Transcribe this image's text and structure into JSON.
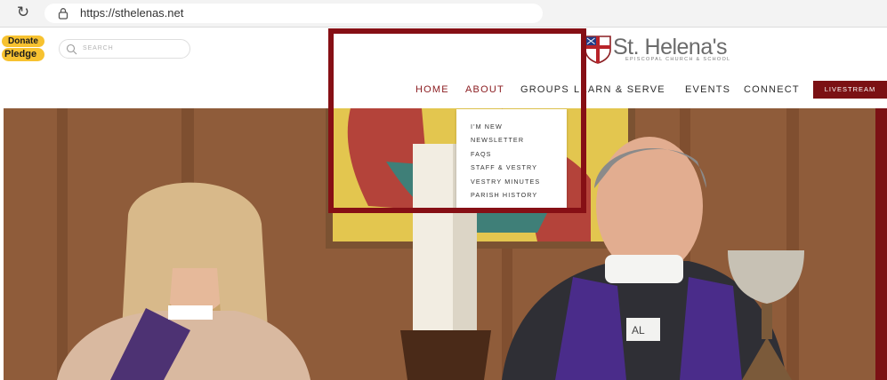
{
  "browser": {
    "url": "https://sthelenas.net",
    "reload_icon": "reload-icon",
    "lock_icon": "lock-icon"
  },
  "header": {
    "donate_label": "Donate",
    "pledge_label": "Pledge",
    "search_placeholder": "SEARCH",
    "search_icon": "search-icon"
  },
  "logo": {
    "name": "St. Helena's",
    "subtitle": "EPISCOPAL CHURCH & SCHOOL",
    "icon": "episcopal-shield-icon"
  },
  "nav": {
    "items": [
      {
        "label": "HOME",
        "active": true
      },
      {
        "label": "ABOUT",
        "active": true
      },
      {
        "label": "GROUPS",
        "active": false
      },
      {
        "label": "LEARN & SERVE",
        "active": false
      },
      {
        "label": "EVENTS",
        "active": false
      },
      {
        "label": "CONNECT",
        "active": false
      }
    ],
    "livestream_label": "LIVESTREAM"
  },
  "dropdown": {
    "items": [
      {
        "label": "I'M NEW"
      },
      {
        "label": "NEWSLETTER"
      },
      {
        "label": "FAQS"
      },
      {
        "label": "STAFF & VESTRY"
      },
      {
        "label": "VESTRY MINUTES"
      },
      {
        "label": "PARISH HISTORY"
      }
    ]
  },
  "colors": {
    "accent": "#8c1e22",
    "livestream_bg": "#7b1114",
    "badge": "#f7c230",
    "highlight": "#860f15"
  },
  "hero": {
    "name_tag_text": "AL"
  }
}
